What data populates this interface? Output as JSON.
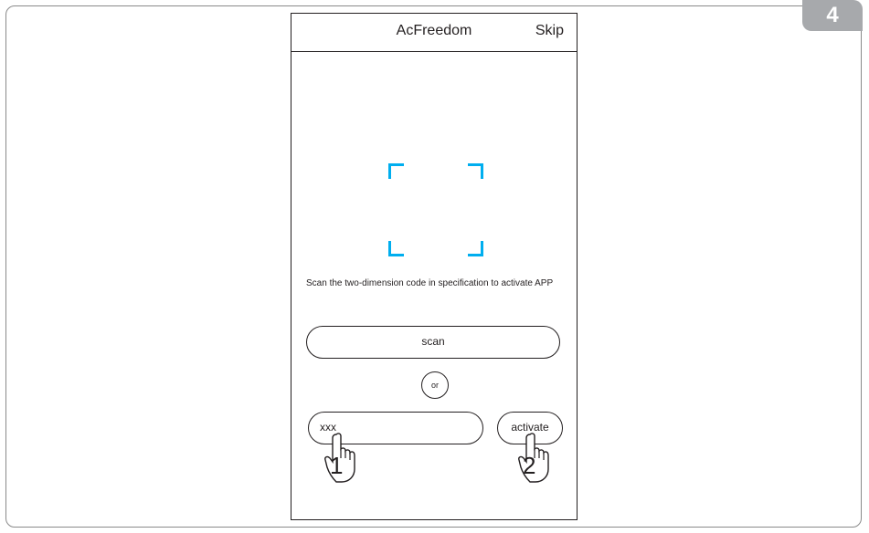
{
  "step": "4",
  "header": {
    "title": "AcFreedom",
    "skip_label": "Skip"
  },
  "scanner": {
    "icon": "qr-scan-frame-icon",
    "accent_color": "#00aeef"
  },
  "instructions": "Scan the two-dimension code in specification to activate APP",
  "scan_button_label": "scan",
  "separator_label": "or",
  "code_input_value": "xxx",
  "activate_button_label": "activate",
  "callouts": [
    {
      "number": "1",
      "icon": "pointing-hand-icon"
    },
    {
      "number": "2",
      "icon": "pointing-hand-icon"
    }
  ]
}
